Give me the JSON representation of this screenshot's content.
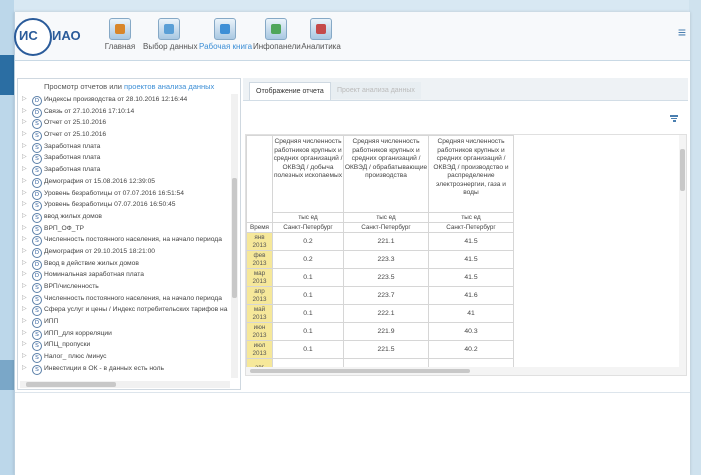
{
  "app": {
    "logo_is": "ИС",
    "logo_iao": "ИАО"
  },
  "nav": [
    {
      "label": "Главная",
      "icon": "home-icon",
      "color": "#d8862a"
    },
    {
      "label": "Выбор данных",
      "icon": "data-select-icon",
      "color": "#5a9fd6"
    },
    {
      "label": "Рабочая книга",
      "icon": "workbook-icon",
      "color": "#3d8fd6"
    },
    {
      "label": "Инфопанели",
      "icon": "dashboard-icon",
      "color": "#4fa65b"
    },
    {
      "label": "Аналитика",
      "icon": "analytics-icon",
      "color": "#c44a4a"
    }
  ],
  "left_panel": {
    "title_prefix": "Просмотр  отчетов или ",
    "title_link": "проектов анализа данных",
    "items": [
      {
        "badge": "D",
        "text": "Индексы производства от 28.10.2016 12:16:44"
      },
      {
        "badge": "D",
        "text": "Связь от 27.10.2016 17:10:14"
      },
      {
        "badge": "S",
        "text": "Отчет от 25.10.2016"
      },
      {
        "badge": "S",
        "text": "Отчет от 25.10.2016"
      },
      {
        "badge": "S",
        "text": "Заработная плата"
      },
      {
        "badge": "S",
        "text": "Заработная плата"
      },
      {
        "badge": "S",
        "text": "Заработная плата"
      },
      {
        "badge": "D",
        "text": "Демография от 15.08.2016 12:39:05"
      },
      {
        "badge": "D",
        "text": "Уровень безработицы от 07.07.2016 16:51:54"
      },
      {
        "badge": "S",
        "text": "Уровень безработицы 07.07.2016 16:50:45"
      },
      {
        "badge": "S",
        "text": "ввод жилых домов"
      },
      {
        "badge": "S",
        "text": "ВРП_ОФ_ТР"
      },
      {
        "badge": "S",
        "text": "Численность постоянного населения, на начало периода"
      },
      {
        "badge": "D",
        "text": "Демография от 29.10.2015 18:21:00"
      },
      {
        "badge": "D",
        "text": "Ввод в действие жилых домов"
      },
      {
        "badge": "D",
        "text": "Номинальная заработная плата"
      },
      {
        "badge": "S",
        "text": "ВРП/численность"
      },
      {
        "badge": "S",
        "text": "Численность постоянного населения, на начало периода"
      },
      {
        "badge": "S",
        "text": "Сфера услуг и цены / Индекс потребительских тарифов на"
      },
      {
        "badge": "D",
        "text": "ИПП"
      },
      {
        "badge": "S",
        "text": "ИПП_для корреляции"
      },
      {
        "badge": "S",
        "text": "ИПЦ_пропуски"
      },
      {
        "badge": "S",
        "text": "Налог_ плюс /минус"
      },
      {
        "badge": "S",
        "text": "Инвестиции в ОК - в данных есть ноль"
      }
    ]
  },
  "tabs": {
    "active": "Отображение отчета",
    "inactive": "Проект анализа данных"
  },
  "table": {
    "headers": [
      "Средняя численность работников крупных и средних организаций / ОКВЭД / добыча полезных ископаемых",
      "Средняя численность работников крупных и средних организаций / ОКВЭД / обрабатывающие производства",
      "Средняя численность работников крупных и средних организаций / ОКВЭД / производство и распределение электроэнергии, газа и воды"
    ],
    "units": [
      "тыс ед",
      "тыс ед",
      "тыс ед"
    ],
    "time_label": "Время",
    "region": "Санкт-Петербург",
    "rows": [
      {
        "m": "янв",
        "y": "2013",
        "v": [
          "0.2",
          "221.1",
          "41.5"
        ]
      },
      {
        "m": "фев",
        "y": "2013",
        "v": [
          "0.2",
          "223.3",
          "41.5"
        ]
      },
      {
        "m": "мар",
        "y": "2013",
        "v": [
          "0.1",
          "223.5",
          "41.5"
        ]
      },
      {
        "m": "апр",
        "y": "2013",
        "v": [
          "0.1",
          "223.7",
          "41.6"
        ]
      },
      {
        "m": "май",
        "y": "2013",
        "v": [
          "0.1",
          "222.1",
          "41"
        ]
      },
      {
        "m": "июн",
        "y": "2013",
        "v": [
          "0.1",
          "221.9",
          "40.3"
        ]
      },
      {
        "m": "июл",
        "y": "2013",
        "v": [
          "0.1",
          "221.5",
          "40.2"
        ]
      },
      {
        "m": "авг",
        "y": "",
        "v": [
          "",
          "",
          ""
        ]
      }
    ]
  }
}
